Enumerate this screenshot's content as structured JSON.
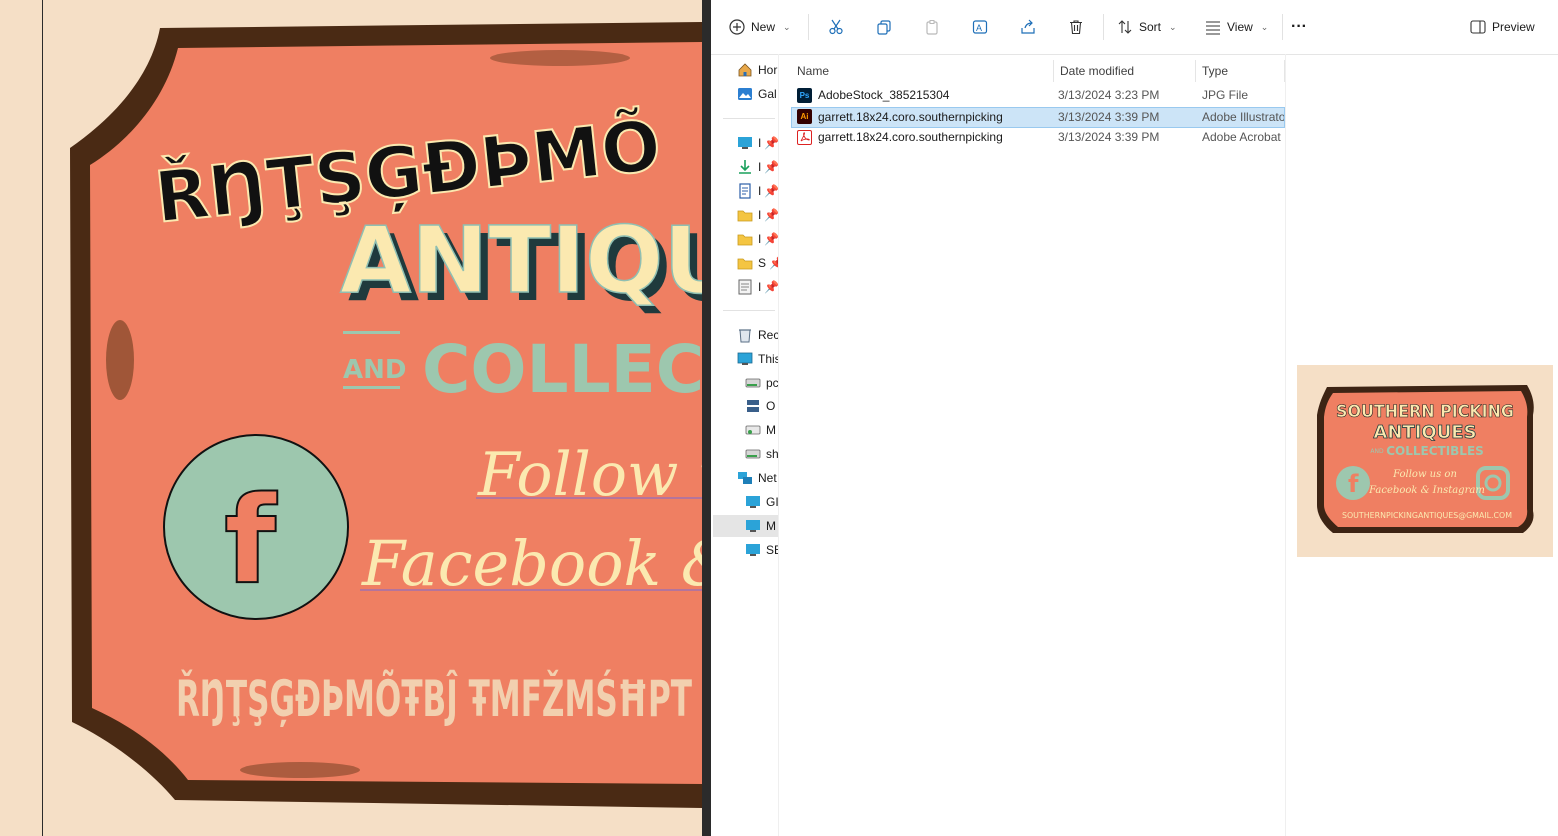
{
  "artboard": {
    "brand_garbled": "ŘŊŢŞĢĐÞMÕ",
    "line_antiques": "ANTIQU",
    "line_and": "AND",
    "line_collectibles": "COLLECTI",
    "follow_line1": "Follow us",
    "follow_line2": "Facebook & In",
    "email_garbled": "ŘŊŢŞĢĐÞMÕŦBĴ ŦMFŽMŚĦPT",
    "facebook_glyph": "f",
    "colors": {
      "sign": "#ef7f62",
      "rust": "#4a2a14",
      "cream": "#fbe9b0",
      "teal": "#9dc7ae",
      "bg": "#f5dfc6"
    }
  },
  "toolbar": {
    "new_label": "New",
    "sort_label": "Sort",
    "view_label": "View",
    "more_label": "···",
    "preview_label": "Preview",
    "icons": [
      "plus-circle-icon",
      "scissors-icon",
      "copy-icon",
      "paste-icon",
      "rename-icon",
      "share-icon",
      "delete-icon",
      "sort-icon",
      "view-icon",
      "more-icon",
      "preview-pane-icon"
    ]
  },
  "nav": {
    "items": [
      {
        "label": "Hor",
        "icon": "home-icon"
      },
      {
        "label": "Gal",
        "icon": "gallery-icon"
      },
      {
        "label": "I",
        "icon": "desktop-icon",
        "pinned": true
      },
      {
        "label": "I",
        "icon": "downloads-icon",
        "pinned": true
      },
      {
        "label": "I",
        "icon": "documents-icon",
        "pinned": true
      },
      {
        "label": "I",
        "icon": "folder-icon",
        "pinned": true
      },
      {
        "label": "I",
        "icon": "folder-icon",
        "pinned": true
      },
      {
        "label": "S",
        "icon": "folder-icon",
        "pinned": true
      },
      {
        "label": "I",
        "icon": "file-icon",
        "pinned": true
      },
      {
        "label": "Rec",
        "icon": "recycle-bin-icon"
      },
      {
        "label": "This",
        "icon": "this-pc-icon"
      },
      {
        "label": "pc",
        "icon": "drive-icon"
      },
      {
        "label": "O",
        "icon": "network-drive-icon"
      },
      {
        "label": "M",
        "icon": "drive-icon"
      },
      {
        "label": "sh",
        "icon": "drive-icon"
      },
      {
        "label": "Net",
        "icon": "network-icon"
      },
      {
        "label": "GI",
        "icon": "computer-icon"
      },
      {
        "label": "M",
        "icon": "computer-icon"
      },
      {
        "label": "SE",
        "icon": "computer-icon"
      }
    ]
  },
  "filelist": {
    "columns": [
      "Name",
      "Date modified",
      "Type"
    ],
    "rows": [
      {
        "name": "AdobeStock_385215304",
        "date": "3/13/2024 3:23 PM",
        "type": "JPG File",
        "badge": "Ps",
        "icon": "photoshop-file-icon"
      },
      {
        "name": "garrett.18x24.coro.southernpicking",
        "date": "3/13/2024 3:39 PM",
        "type": "Adobe Illustrator",
        "badge": "Ai",
        "icon": "illustrator-file-icon"
      },
      {
        "name": "garrett.18x24.coro.southernpicking",
        "date": "3/13/2024 3:39 PM",
        "type": "Adobe Acrobat",
        "badge": "",
        "icon": "pdf-file-icon"
      }
    ]
  },
  "preview": {
    "title_line1": "SOUTHERN PICKING",
    "title_line2": "ANTIQUES",
    "title_and": "AND",
    "title_line3": "COLLECTIBLES",
    "follow1": "Follow us on",
    "follow2": "Facebook & Instagram",
    "email": "SOUTHERNPICKINGANTIQUES@GMAIL.COM"
  }
}
